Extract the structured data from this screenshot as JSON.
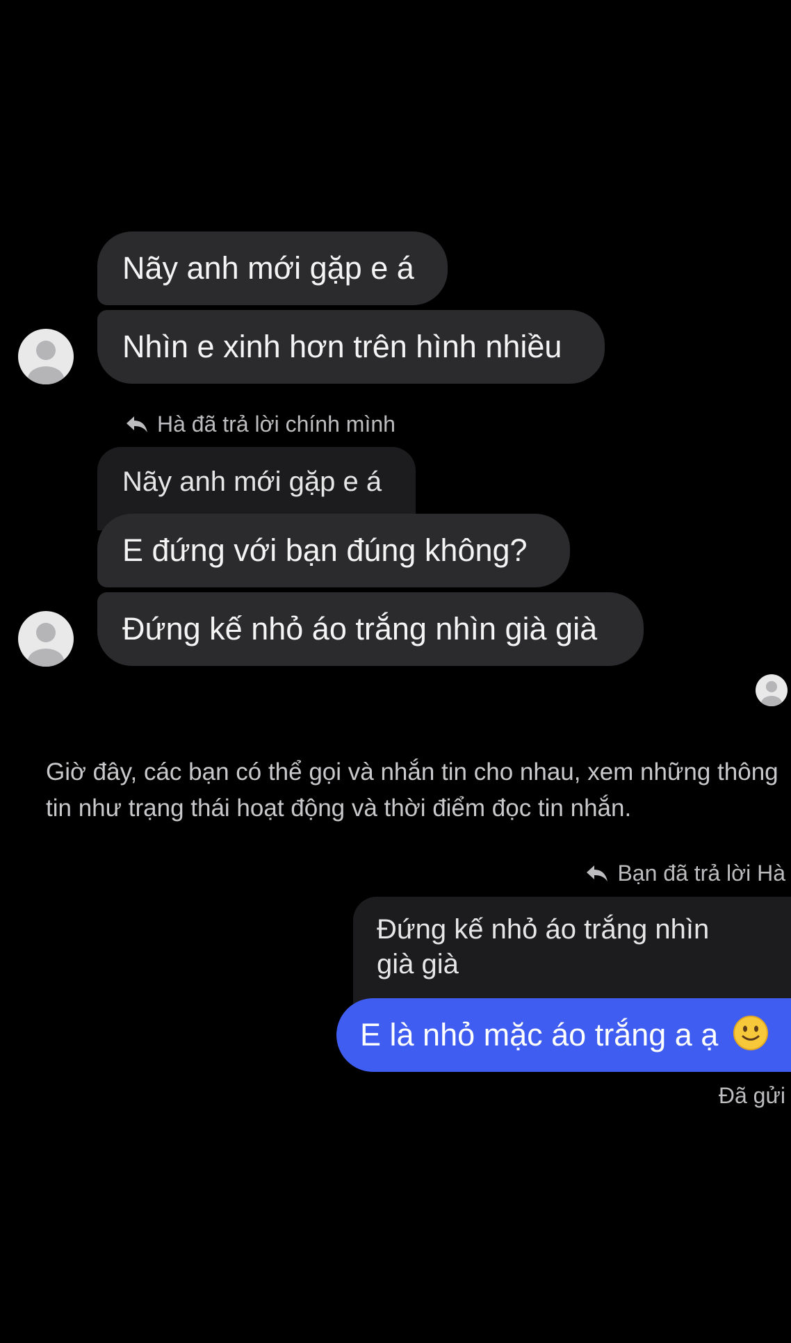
{
  "thread": {
    "incoming_group_1": [
      {
        "text": "Nãy anh mới gặp e á"
      },
      {
        "text": "Nhìn e xinh hơn trên hình nhiều"
      }
    ],
    "reply_note_1": "Hà đã trả lời chính mình",
    "quoted_1": "Nãy anh mới gặp e á",
    "incoming_group_2": [
      {
        "text": "E đứng với bạn đúng không?"
      },
      {
        "text": "Đứng kế nhỏ áo trắng nhìn già già"
      }
    ],
    "system_message": "Giờ đây, các bạn có thể gọi và nhắn tin cho nhau, xem những thông tin như trạng thái hoạt động và thời điểm đọc tin nhắn.",
    "reply_note_2": "Bạn đã trả lời Hà",
    "quoted_2_line1": "Đứng kế nhỏ áo trắng nhìn",
    "quoted_2_line2": "già già",
    "outgoing": {
      "text": "E là nhỏ mặc áo trắng a ạ",
      "emoji": "slightly-smiling-face-icon"
    },
    "status": "Đã gửi"
  },
  "colors": {
    "background": "#000000",
    "incoming_bubble": "#2b2b2d",
    "outgoing_bubble": "#3f5df0",
    "secondary_text": "#bdbdc0"
  }
}
